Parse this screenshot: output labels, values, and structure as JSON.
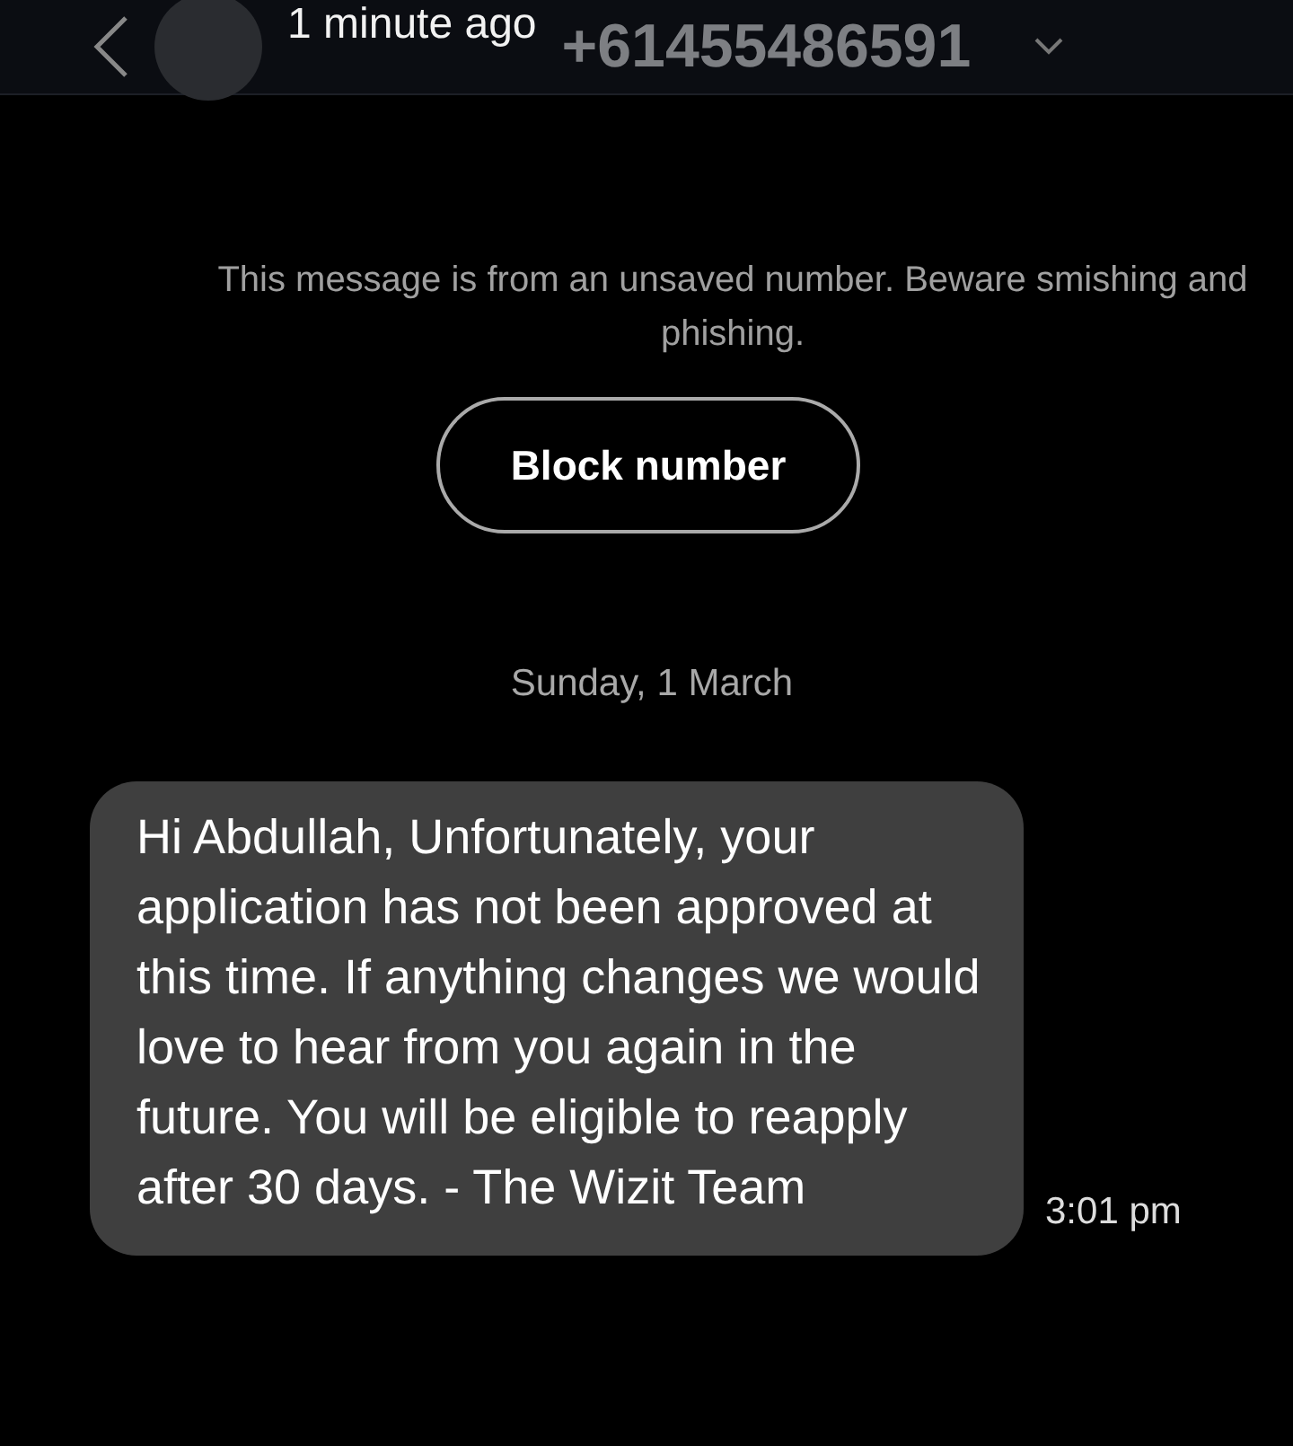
{
  "header": {
    "time": "1 minute ago",
    "number": "+61455486591"
  },
  "notice": {
    "text": "This message is from an unsaved number. Beware smishing and phishing.",
    "button": "Block number"
  },
  "date": "Sunday, 1 March",
  "messages": [
    {
      "text": "Hi Abdullah, Unfortunately, your application has not been approved at this time. If anything changes we would love to hear from you again in the future. You will be eligible to reapply after 30 days. - The Wizit Team",
      "time": "3:01 pm"
    }
  ]
}
